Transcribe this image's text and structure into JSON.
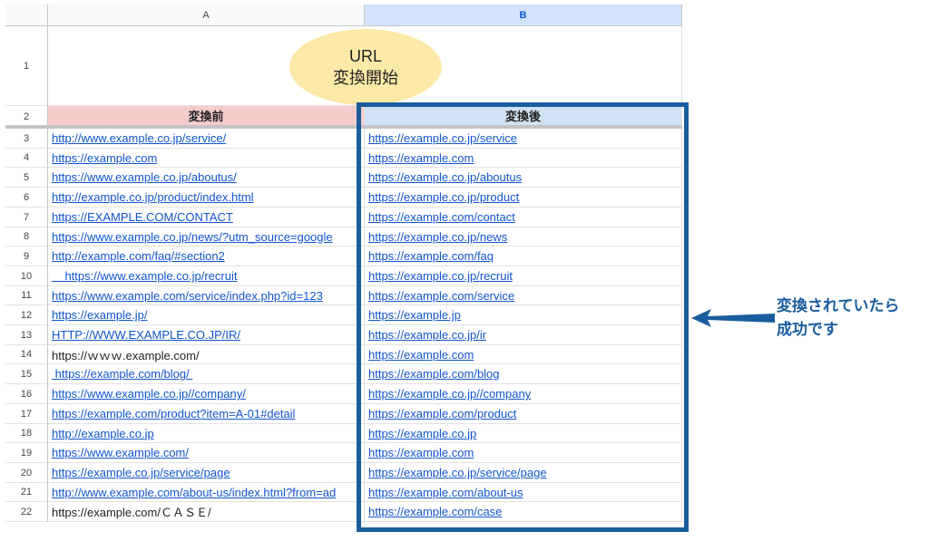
{
  "sheet": {
    "columns": [
      {
        "label": "A",
        "selected": false
      },
      {
        "label": "B",
        "selected": true
      }
    ],
    "row1_number": "1",
    "row2_number": "2",
    "run_button": {
      "line1": "URL",
      "line2": "変換開始"
    },
    "header_before": "変換前",
    "header_after": "変換後",
    "header_before_color": "#f4cccc",
    "header_after_color": "#cfe2f3",
    "rows": [
      {
        "num": "3",
        "before": "http://www.example.co.jp/service/",
        "before_link": true,
        "after": "https://example.co.jp/service"
      },
      {
        "num": "4",
        "before": "https://example.com",
        "before_link": true,
        "after": "https://example.com"
      },
      {
        "num": "5",
        "before": "https://www.example.co.jp/aboutus/",
        "before_link": true,
        "after": "https://example.co.jp/aboutus"
      },
      {
        "num": "6",
        "before": "http://example.co.jp/product/index.html",
        "before_link": true,
        "after": "https://example.co.jp/product"
      },
      {
        "num": "7",
        "before": "https://EXAMPLE.COM/CONTACT",
        "before_link": true,
        "after": "https://example.com/contact"
      },
      {
        "num": "8",
        "before": "https://www.example.co.jp/news/?utm_source=google",
        "before_link": true,
        "after": "https://example.co.jp/news"
      },
      {
        "num": "9",
        "before": "http://example.com/faq/#section2",
        "before_link": true,
        "after": "https://example.com/faq"
      },
      {
        "num": "10",
        "before": "    https://www.example.co.jp/recruit",
        "before_link": true,
        "after": "https://example.co.jp/recruit"
      },
      {
        "num": "11",
        "before": "https://www.example.com/service/index.php?id=123",
        "before_link": true,
        "after": "https://example.com/service"
      },
      {
        "num": "12",
        "before": "https://example.jp/",
        "before_link": true,
        "after": "https://example.jp"
      },
      {
        "num": "13",
        "before": "HTTP://WWW.EXAMPLE.CO.JP/IR/",
        "before_link": true,
        "after": "https://example.co.jp/ir"
      },
      {
        "num": "14",
        "before": "https://ｗｗｗ.example.com/",
        "before_link": false,
        "after": "https://example.com"
      },
      {
        "num": "15",
        "before": " https://example.com/blog/ ",
        "before_link": true,
        "after": "https://example.com/blog"
      },
      {
        "num": "16",
        "before": "https://www.example.co.jp//company/",
        "before_link": true,
        "after": "https://example.co.jp//company"
      },
      {
        "num": "17",
        "before": "https://example.com/product?item=A-01#detail",
        "before_link": true,
        "after": "https://example.com/product"
      },
      {
        "num": "18",
        "before": "http://example.co.jp",
        "before_link": true,
        "after": "https://example.co.jp"
      },
      {
        "num": "19",
        "before": "https://www.example.com/",
        "before_link": true,
        "after": "https://example.com"
      },
      {
        "num": "20",
        "before": "https://example.co.jp/service/page",
        "before_link": true,
        "after": "https://example.co.jp/service/page"
      },
      {
        "num": "21",
        "before": "http://www.example.com/about-us/index.html?from=ad",
        "before_link": true,
        "after": "https://example.com/about-us"
      },
      {
        "num": "22",
        "before": "https://example.com/ＣＡＳＥ/",
        "before_link": false,
        "after": "https://example.com/case"
      }
    ]
  },
  "annotation": {
    "line1": "変換されていたら",
    "line2": "成功です",
    "color": "#1a5d9e"
  }
}
